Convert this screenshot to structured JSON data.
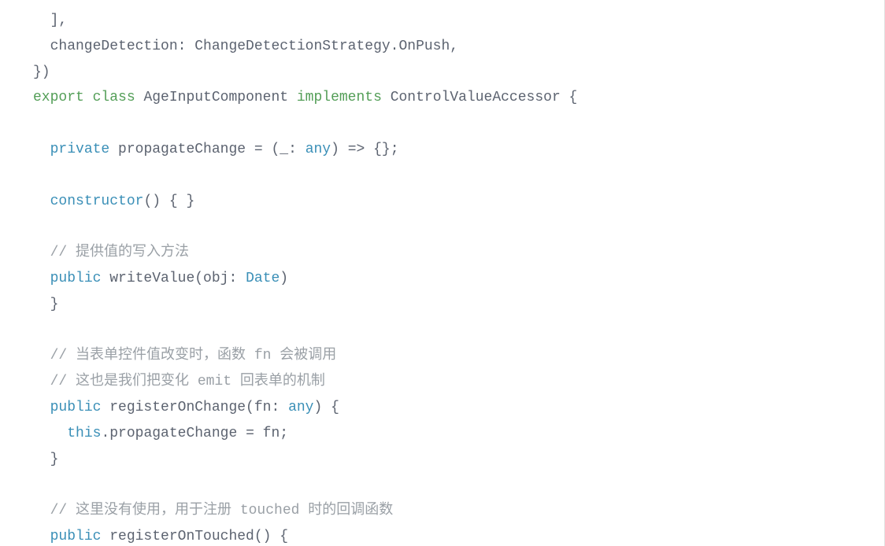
{
  "code": {
    "lines": [
      [
        {
          "cls": "tok-punc",
          "t": "  ],"
        }
      ],
      [
        {
          "cls": "tok-ident",
          "t": "  changeDetection: ChangeDetectionStrategy.OnPush,"
        }
      ],
      [
        {
          "cls": "tok-punc",
          "t": "})"
        }
      ],
      [
        {
          "cls": "tok-keyword",
          "t": "export"
        },
        {
          "cls": "tok-default",
          "t": " "
        },
        {
          "cls": "tok-keyword",
          "t": "class"
        },
        {
          "cls": "tok-default",
          "t": " AgeInputComponent "
        },
        {
          "cls": "tok-keyword",
          "t": "implements"
        },
        {
          "cls": "tok-default",
          "t": " ControlValueAccessor {"
        }
      ],
      [
        {
          "cls": "tok-default",
          "t": ""
        }
      ],
      [
        {
          "cls": "tok-default",
          "t": "  "
        },
        {
          "cls": "tok-modifier",
          "t": "private"
        },
        {
          "cls": "tok-default",
          "t": " propagateChange = (_: "
        },
        {
          "cls": "tok-modifier",
          "t": "any"
        },
        {
          "cls": "tok-default",
          "t": ") => {};"
        }
      ],
      [
        {
          "cls": "tok-default",
          "t": ""
        }
      ],
      [
        {
          "cls": "tok-default",
          "t": "  "
        },
        {
          "cls": "tok-modifier",
          "t": "constructor"
        },
        {
          "cls": "tok-default",
          "t": "() { }"
        }
      ],
      [
        {
          "cls": "tok-default",
          "t": ""
        }
      ],
      [
        {
          "cls": "tok-default",
          "t": "  "
        },
        {
          "cls": "tok-comment",
          "t": "// 提供值的写入方法"
        }
      ],
      [
        {
          "cls": "tok-default",
          "t": "  "
        },
        {
          "cls": "tok-modifier",
          "t": "public"
        },
        {
          "cls": "tok-default",
          "t": " writeValue(obj: "
        },
        {
          "cls": "tok-modifier",
          "t": "Date"
        },
        {
          "cls": "tok-default",
          "t": ")"
        }
      ],
      [
        {
          "cls": "tok-default",
          "t": "  }"
        }
      ],
      [
        {
          "cls": "tok-default",
          "t": ""
        }
      ],
      [
        {
          "cls": "tok-default",
          "t": "  "
        },
        {
          "cls": "tok-comment",
          "t": "// 当表单控件值改变时，函数 fn 会被调用"
        }
      ],
      [
        {
          "cls": "tok-default",
          "t": "  "
        },
        {
          "cls": "tok-comment",
          "t": "// 这也是我们把变化 emit 回表单的机制"
        }
      ],
      [
        {
          "cls": "tok-default",
          "t": "  "
        },
        {
          "cls": "tok-modifier",
          "t": "public"
        },
        {
          "cls": "tok-default",
          "t": " registerOnChange(fn: "
        },
        {
          "cls": "tok-modifier",
          "t": "any"
        },
        {
          "cls": "tok-default",
          "t": ") {"
        }
      ],
      [
        {
          "cls": "tok-default",
          "t": "    "
        },
        {
          "cls": "tok-modifier",
          "t": "this"
        },
        {
          "cls": "tok-default",
          "t": ".propagateChange = fn;"
        }
      ],
      [
        {
          "cls": "tok-default",
          "t": "  }"
        }
      ],
      [
        {
          "cls": "tok-default",
          "t": ""
        }
      ],
      [
        {
          "cls": "tok-default",
          "t": "  "
        },
        {
          "cls": "tok-comment",
          "t": "// 这里没有使用，用于注册 touched 时的回调函数"
        }
      ],
      [
        {
          "cls": "tok-default",
          "t": "  "
        },
        {
          "cls": "tok-modifier",
          "t": "public"
        },
        {
          "cls": "tok-default",
          "t": " registerOnTouched() {"
        }
      ]
    ]
  }
}
